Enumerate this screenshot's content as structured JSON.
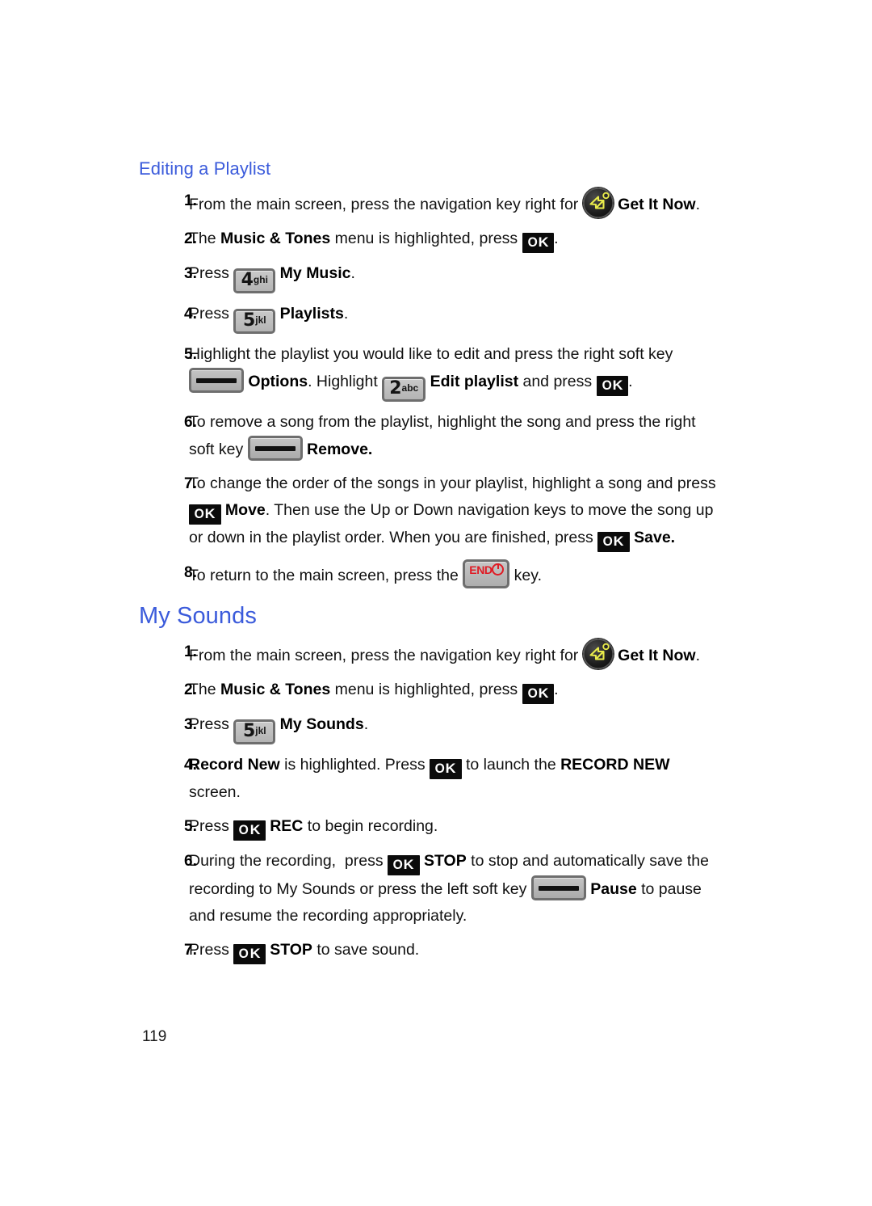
{
  "document": {
    "page_number": "119",
    "heading_color": "#3b5bdb"
  },
  "sections": [
    {
      "id": "editing-a-playlist",
      "heading": "Editing a Playlist",
      "heading_size": "small",
      "steps": [
        {
          "number": "1.",
          "parts": [
            {
              "type": "text",
              "value": "From the main screen, press the navigation key right for "
            },
            {
              "type": "key-gin",
              "label": "get-it-now-icon"
            },
            {
              "type": "bold",
              "value": " Get It Now"
            },
            {
              "type": "text",
              "value": "."
            }
          ]
        },
        {
          "number": "2.",
          "parts": [
            {
              "type": "text",
              "value": "The "
            },
            {
              "type": "bold",
              "value": "Music & Tones"
            },
            {
              "type": "text",
              "value": " menu is highlighted, press "
            },
            {
              "type": "key-ok",
              "label": "OK"
            },
            {
              "type": "text",
              "value": "."
            }
          ]
        },
        {
          "number": "3.",
          "parts": [
            {
              "type": "text",
              "value": "Press "
            },
            {
              "type": "key-num",
              "digit": "4",
              "letters": "ghi"
            },
            {
              "type": "bold",
              "value": " My Music"
            },
            {
              "type": "text",
              "value": "."
            }
          ]
        },
        {
          "number": "4.",
          "parts": [
            {
              "type": "text",
              "value": "Press "
            },
            {
              "type": "key-num",
              "digit": "5",
              "letters": "jkl"
            },
            {
              "type": "bold",
              "value": " Playlists"
            },
            {
              "type": "text",
              "value": "."
            }
          ]
        },
        {
          "number": "5.",
          "parts": [
            {
              "type": "text",
              "value": "Highlight the playlist you would like to edit and press the right soft key "
            },
            {
              "type": "key-soft",
              "label": "soft-key"
            },
            {
              "type": "bold",
              "value": " Options"
            },
            {
              "type": "text",
              "value": ". Highlight "
            },
            {
              "type": "key-num",
              "digit": "2",
              "letters": "abc"
            },
            {
              "type": "bold",
              "value": " Edit playlist"
            },
            {
              "type": "text",
              "value": " and press "
            },
            {
              "type": "key-ok",
              "label": "OK"
            },
            {
              "type": "text",
              "value": "."
            }
          ]
        },
        {
          "number": "6.",
          "parts": [
            {
              "type": "text",
              "value": "To remove a song from the playlist, highlight the song and press the right soft key "
            },
            {
              "type": "key-soft",
              "label": "soft-key"
            },
            {
              "type": "bold",
              "value": " Remove."
            }
          ]
        },
        {
          "number": "7.",
          "parts": [
            {
              "type": "text",
              "value": "To change the order of the songs in your playlist, highlight a song and press "
            },
            {
              "type": "key-ok",
              "label": "OK"
            },
            {
              "type": "bold",
              "value": " Move"
            },
            {
              "type": "text",
              "value": ". Then use the Up or Down navigation keys to move the song up or down in the playlist order. When you are finished, press "
            },
            {
              "type": "key-ok",
              "label": "OK"
            },
            {
              "type": "bold",
              "value": " Save."
            }
          ]
        },
        {
          "number": "8.",
          "parts": [
            {
              "type": "text",
              "value": "To return to the main screen, press the "
            },
            {
              "type": "key-end",
              "label": "END"
            },
            {
              "type": "text",
              "value": " key."
            }
          ]
        }
      ]
    },
    {
      "id": "my-sounds",
      "heading": "My Sounds",
      "heading_size": "big",
      "steps": [
        {
          "number": "1.",
          "parts": [
            {
              "type": "text",
              "value": "From the main screen, press the navigation key right for "
            },
            {
              "type": "key-gin",
              "label": "get-it-now-icon"
            },
            {
              "type": "bold",
              "value": " Get It Now"
            },
            {
              "type": "text",
              "value": "."
            }
          ]
        },
        {
          "number": "2.",
          "parts": [
            {
              "type": "text",
              "value": "The "
            },
            {
              "type": "bold",
              "value": "Music & Tones"
            },
            {
              "type": "text",
              "value": " menu is highlighted, press "
            },
            {
              "type": "key-ok",
              "label": "OK"
            },
            {
              "type": "text",
              "value": "."
            }
          ]
        },
        {
          "number": "3.",
          "parts": [
            {
              "type": "text",
              "value": "Press "
            },
            {
              "type": "key-num",
              "digit": "5",
              "letters": "jkl"
            },
            {
              "type": "bold",
              "value": " My Sounds"
            },
            {
              "type": "text",
              "value": "."
            }
          ]
        },
        {
          "number": "4.",
          "parts": [
            {
              "type": "bold",
              "value": "Record New"
            },
            {
              "type": "text",
              "value": " is highlighted. Press "
            },
            {
              "type": "key-ok",
              "label": "OK"
            },
            {
              "type": "text",
              "value": " to launch the "
            },
            {
              "type": "bold",
              "value": "RECORD NEW"
            },
            {
              "type": "text",
              "value": " screen."
            }
          ]
        },
        {
          "number": "5.",
          "parts": [
            {
              "type": "text",
              "value": "Press "
            },
            {
              "type": "key-ok",
              "label": "OK"
            },
            {
              "type": "bold",
              "value": " REC"
            },
            {
              "type": "text",
              "value": " to begin recording."
            }
          ]
        },
        {
          "number": "6.",
          "parts": [
            {
              "type": "text",
              "value": "During the recording,  press "
            },
            {
              "type": "key-ok",
              "label": "OK"
            },
            {
              "type": "bold",
              "value": " STOP"
            },
            {
              "type": "text",
              "value": " to stop and automatically save the recording to My Sounds or press the left soft key "
            },
            {
              "type": "key-soft",
              "label": "soft-key"
            },
            {
              "type": "bold",
              "value": " Pause"
            },
            {
              "type": "text",
              "value": " to pause and resume the recording appropriately."
            }
          ]
        },
        {
          "number": "7.",
          "parts": [
            {
              "type": "text",
              "value": "Press "
            },
            {
              "type": "key-ok",
              "label": "OK"
            },
            {
              "type": "bold",
              "value": " STOP"
            },
            {
              "type": "text",
              "value": " to save sound."
            }
          ]
        }
      ]
    }
  ]
}
